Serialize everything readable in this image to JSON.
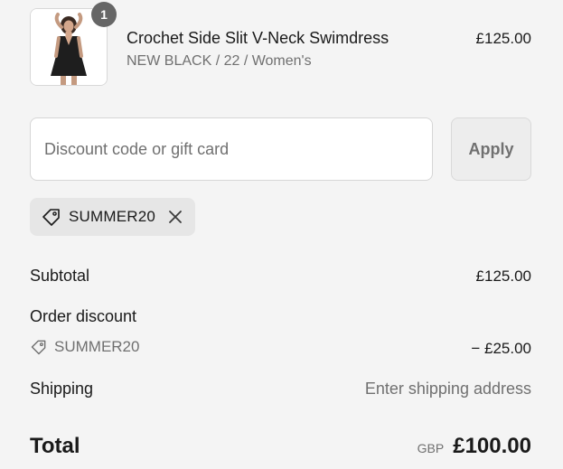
{
  "product": {
    "name": "Crochet Side Slit V-Neck Swimdress",
    "variant": "NEW BLACK / 22 / Women's",
    "price": "£125.00",
    "quantity": "1",
    "image_icon": "product-photo-swimdress"
  },
  "discount": {
    "placeholder": "Discount code or gift card",
    "value": "",
    "apply_label": "Apply",
    "applied_code": "SUMMER20"
  },
  "summary": {
    "subtotal_label": "Subtotal",
    "subtotal_value": "£125.00",
    "order_discount_label": "Order discount",
    "discount_code": "SUMMER20",
    "discount_value": "− £25.00",
    "shipping_label": "Shipping",
    "shipping_value": "Enter shipping address",
    "total_label": "Total",
    "total_currency": "GBP",
    "total_value": "£100.00"
  },
  "colors": {
    "background": "#f4f4f4",
    "badge": "#666666",
    "muted_text": "#707070",
    "pill_background": "#e6e6e6"
  }
}
